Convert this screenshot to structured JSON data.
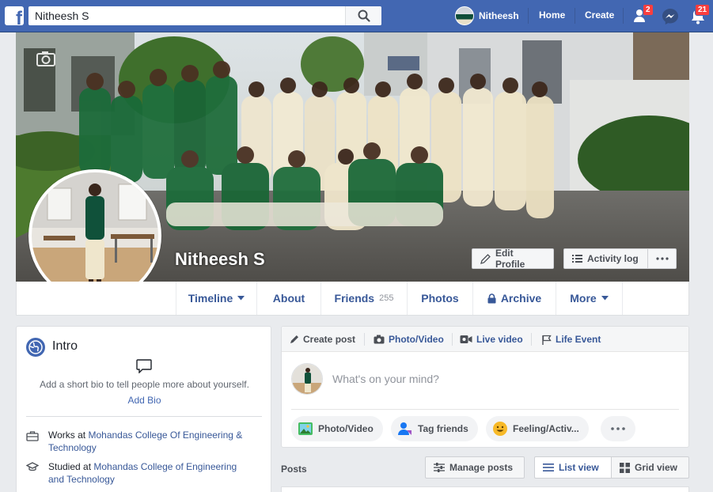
{
  "topbar": {
    "search_value": "Nitheesh S",
    "profile_name": "Nitheesh",
    "home_label": "Home",
    "create_label": "Create",
    "friend_requests_badge": "2",
    "notifications_badge": "21"
  },
  "cover": {
    "name": "Nitheesh S",
    "edit_profile_label": "Edit Profile",
    "activity_log_label": "Activity log"
  },
  "profile_nav": {
    "timeline": "Timeline",
    "about": "About",
    "friends": "Friends",
    "friends_count": "255",
    "photos": "Photos",
    "archive": "Archive",
    "more": "More"
  },
  "intro": {
    "title": "Intro",
    "bio_prompt": "Add a short bio to tell people more about yourself.",
    "add_bio": "Add Bio",
    "works_prefix": "Works at",
    "works_at_line1": "Mohandas College Of Engineering &",
    "works_at_line2": "Technology",
    "studied_prefix": "Studied at",
    "studied_at_line1": "Mohandas College of Engineering",
    "studied_at_line2": "and Technology"
  },
  "composer": {
    "create_post": "Create post",
    "photo_video_tab": "Photo/Video",
    "live_video": "Live video",
    "life_event": "Life Event",
    "placeholder": "What's on your mind?",
    "photo_video_pill": "Photo/Video",
    "tag_friends": "Tag friends",
    "feeling": "Feeling/Activ..."
  },
  "posts": {
    "label": "Posts",
    "manage_posts": "Manage posts",
    "list_view": "List view",
    "grid_view": "Grid view"
  },
  "colors": {
    "brand": "#4267b2",
    "link": "#385898",
    "badge": "#fa3e3e"
  }
}
